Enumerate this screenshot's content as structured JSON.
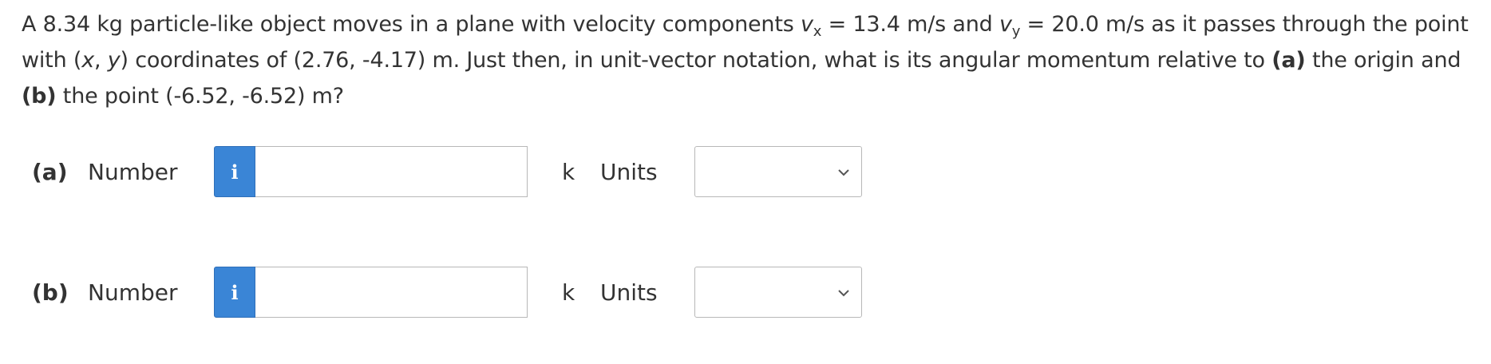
{
  "question": {
    "line1": {
      "t1": "A 8.34 kg particle-like object moves in a plane with velocity components ",
      "v1": "v",
      "s1": "x",
      "t2": " = 13.4 m/s and ",
      "v2": "v",
      "s2": "y",
      "t3": " = 20.0 m/s as it passes through the point"
    },
    "line2": {
      "t1": "with (",
      "x": "x",
      "t2": ", ",
      "y": "y",
      "t3": ") coordinates of (2.76, -4.17) m. Just then, in unit-vector notation, what is its angular momentum relative to ",
      "a": "(a)",
      "t4": " the origin and"
    },
    "line3": {
      "b": "(b)",
      "t1": " the point (-6.52, -6.52) m?"
    }
  },
  "parts": [
    {
      "label": "(a)",
      "number_label": "Number",
      "info_glyph": "i",
      "input_value": "",
      "unit_vector": "k",
      "units_label": "Units",
      "units_selected": ""
    },
    {
      "label": "(b)",
      "number_label": "Number",
      "info_glyph": "i",
      "input_value": "",
      "unit_vector": "k",
      "units_label": "Units",
      "units_selected": ""
    }
  ],
  "colors": {
    "text": "#333333",
    "info_button": "#3a85d6",
    "border": "#b8b8b8"
  },
  "icons": {
    "info": "info-icon",
    "dropdown": "chevron-down-icon"
  }
}
